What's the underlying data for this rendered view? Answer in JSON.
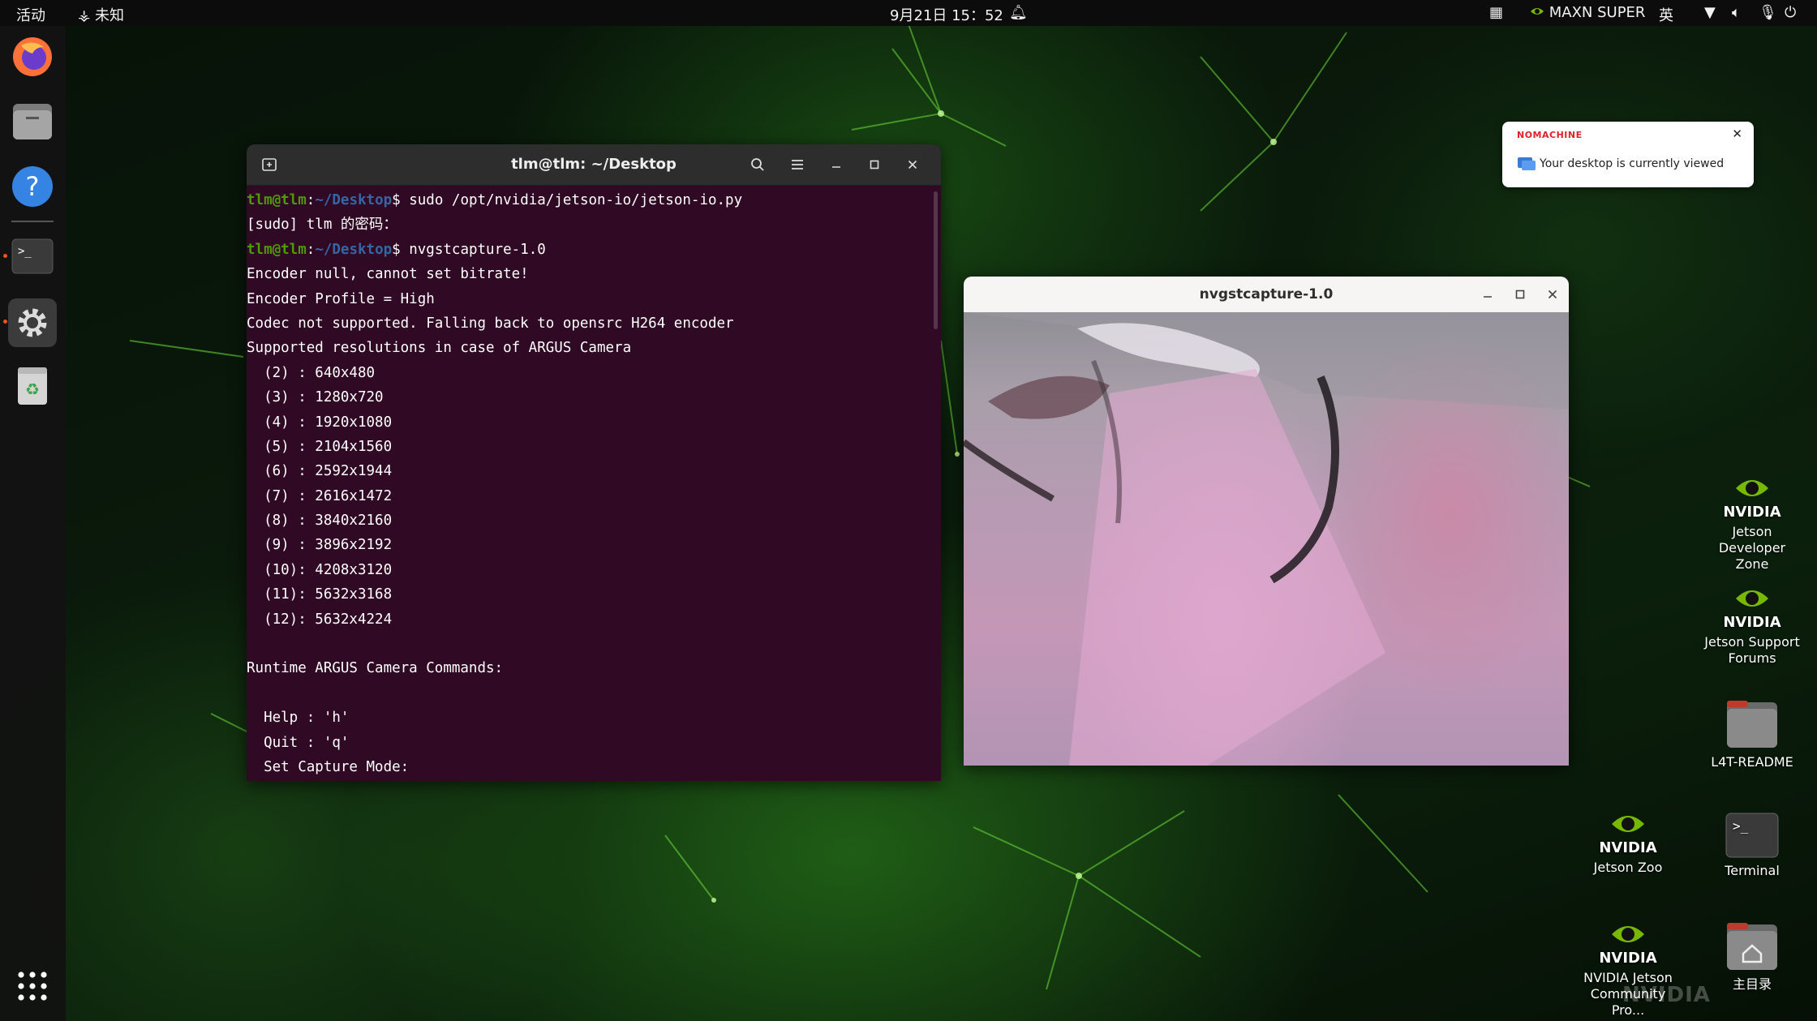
{
  "topbar": {
    "activities": "活动",
    "network_label": "未知",
    "datetime": "9月21日 15：52",
    "power_mode": "MAXN SUPER",
    "input_method": "英"
  },
  "dock": {
    "items": [
      "firefox-icon",
      "files-icon",
      "help-icon",
      "terminal-icon",
      "settings-icon",
      "trash-icon",
      "app-grid-icon"
    ]
  },
  "terminal": {
    "title": "tlm@tlm: ~/Desktop",
    "prompt_user": "tlm@tlm",
    "prompt_sep": ":",
    "prompt_path": "~/Desktop",
    "prompt_symbol": "$",
    "cmd1": " sudo /opt/nvidia/jetson-io/jetson-io.py",
    "cmd2": " nvgstcapture-1.0",
    "output": [
      "[sudo] tlm 的密码：",
      "",
      "Encoder null, cannot set bitrate!",
      "Encoder Profile = High",
      "Codec not supported. Falling back to opensrc H264 encoder",
      "Supported resolutions in case of ARGUS Camera",
      "  (2) : 640x480",
      "  (3) : 1280x720",
      "  (4) : 1920x1080",
      "  (5) : 2104x1560",
      "  (6) : 2592x1944",
      "  (7) : 2616x1472",
      "  (8) : 3840x2160",
      "  (9) : 3896x2192",
      "  (10): 4208x3120",
      "  (11): 5632x3168",
      "  (12): 5632x4224",
      "",
      "Runtime ARGUS Camera Commands:",
      "",
      "  Help : 'h'",
      "  Quit : 'q'",
      "  Set Capture Mode:"
    ]
  },
  "camera_window": {
    "title": "nvgstcapture-1.0"
  },
  "notification": {
    "brand": "NOMACHINE",
    "message": "Your desktop is currently viewed"
  },
  "desktop_icons": {
    "dev_zone": "Jetson Developer Zone",
    "dev_zone_l1": "Jetson Developer",
    "dev_zone_l2": "Zone",
    "forums_l1": "Jetson Support",
    "forums_l2": "Forums",
    "readme": "L4T-README",
    "zoo": "Jetson Zoo",
    "terminal": "Terminal",
    "community_l1": "NVIDIA Jetson",
    "community_l2": "Community Pro...",
    "home": "主目录",
    "nvidia_text": "NVIDIA"
  },
  "colors": {
    "terminal_bg": "#300a24",
    "prompt_user": "#4e9a06",
    "prompt_path": "#3465a4",
    "accent": "#e95420",
    "nvidia_green": "#76b900"
  }
}
